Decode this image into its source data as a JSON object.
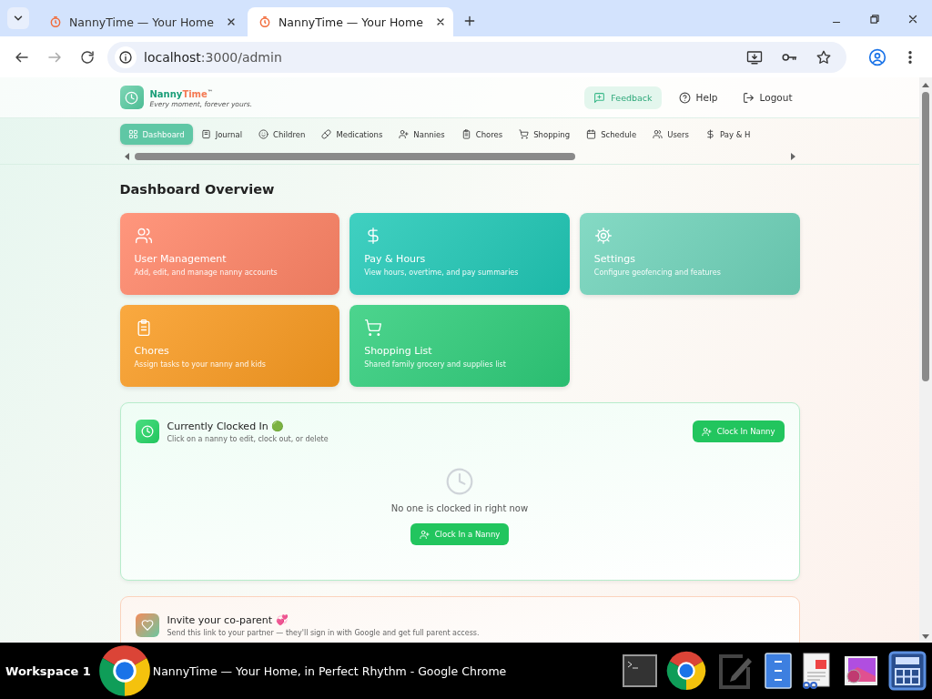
{
  "browser": {
    "tabs": [
      {
        "title": "NannyTime — Your Home",
        "selected": false
      },
      {
        "title": "NannyTime — Your Home",
        "selected": true
      }
    ],
    "address_host": "localhost",
    "address_path": ":3000/admin"
  },
  "header": {
    "brand_first": "Nanny",
    "brand_second": "Time",
    "trademark": "™",
    "tagline": "Every moment, forever yours.",
    "actions": [
      {
        "label": "Feedback",
        "kind": "feedback"
      },
      {
        "label": "Help",
        "kind": "help"
      },
      {
        "label": "Logout",
        "kind": "logout"
      }
    ]
  },
  "nav": [
    {
      "label": "Dashboard",
      "selected": true
    },
    {
      "label": "Journal",
      "selected": false
    },
    {
      "label": "Children",
      "selected": false
    },
    {
      "label": "Medications",
      "selected": false
    },
    {
      "label": "Nannies",
      "selected": false
    },
    {
      "label": "Chores",
      "selected": false
    },
    {
      "label": "Shopping",
      "selected": false
    },
    {
      "label": "Schedule",
      "selected": false
    },
    {
      "label": "Users",
      "selected": false
    },
    {
      "label": "Pay & H",
      "selected": false
    }
  ],
  "page_title": "Dashboard Overview",
  "cards": [
    {
      "title": "User Management",
      "subtitle": "Add, edit, and manage nanny accounts",
      "color": "#ff8466"
    },
    {
      "title": "Pay & Hours",
      "subtitle": "View hours, overtime, and pay summaries",
      "color": "#1ec8b6"
    },
    {
      "title": "Settings",
      "subtitle": "Configure geofencing and features",
      "color": "#6fd3ba"
    },
    {
      "title": "Chores",
      "subtitle": "Assign tasks to your nanny and kids",
      "color": "#f99a1e"
    },
    {
      "title": "Shopping List",
      "subtitle": "Shared family grocery and supplies list",
      "color": "#2dcd7a"
    }
  ],
  "clocked_panel": {
    "title": "Currently Clocked In 🟢",
    "subtitle": "Click on a nanny to edit, clock out, or delete",
    "header_button": "Clock In Nanny",
    "empty_text": "No one is clocked in right now",
    "empty_button": "Clock In a Nanny"
  },
  "invite_panel": {
    "title": "Invite your co-parent 💞",
    "subtitle": "Send this link to your partner — they'll sign in with Google and get full parent access."
  },
  "taskbar": {
    "workspace": "Workspace 1",
    "window_title": "NannyTime — Your Home, in Perfect Rhythm - Google Chrome"
  }
}
